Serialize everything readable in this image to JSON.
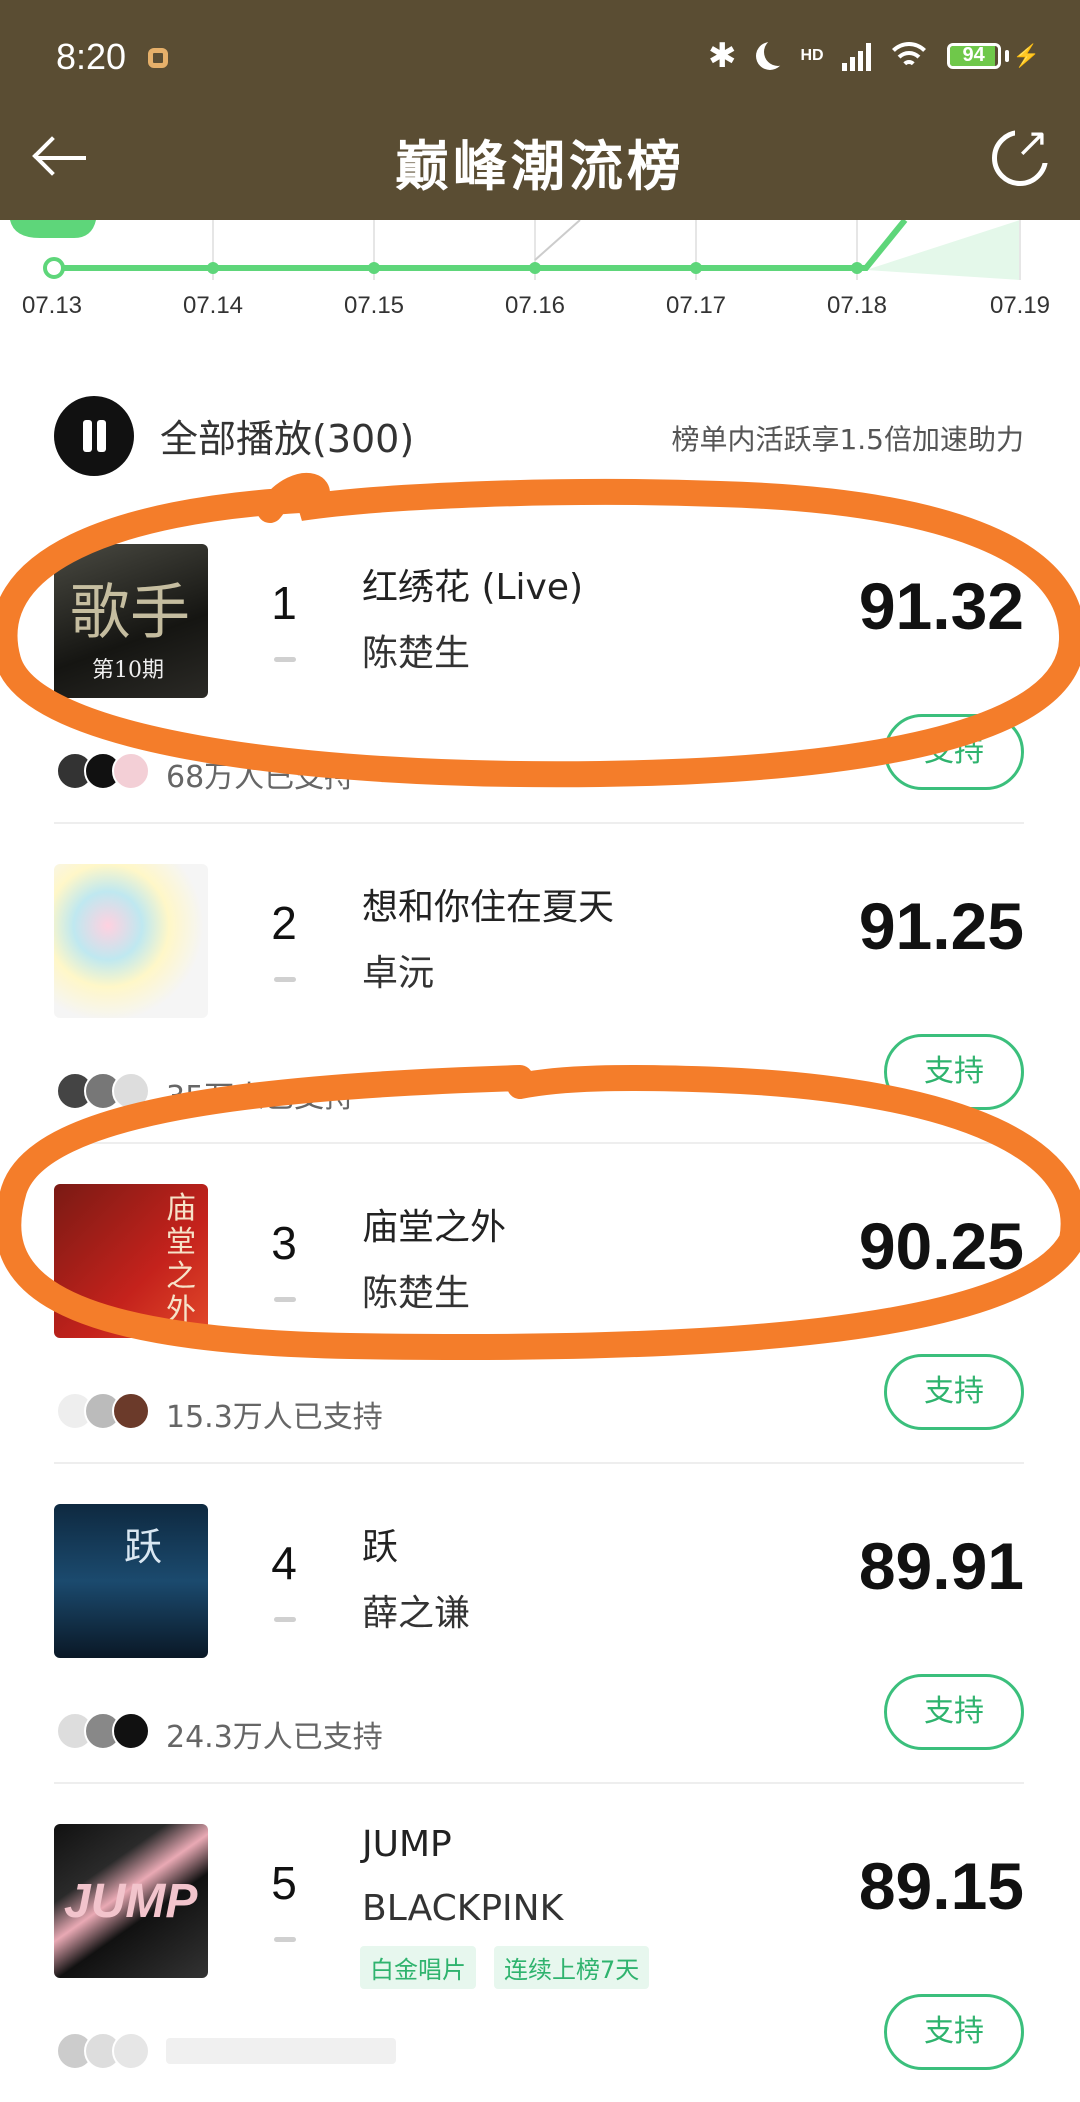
{
  "status": {
    "time": "8:20",
    "network_badge": "HD",
    "battery": "94",
    "battery_level": 0.94
  },
  "header": {
    "title": "巅峰潮流榜",
    "back_icon": "arrow-left-icon",
    "share_icon": "share-icon"
  },
  "trend": {
    "dates": [
      "07.13",
      "07.14",
      "07.15",
      "07.16",
      "07.17",
      "07.18",
      "07.19"
    ],
    "line_color": "#5ed67a"
  },
  "playbar": {
    "play_all": "全部播放(300)",
    "boost_text": "榜单内活跃享1.5倍加速助力"
  },
  "colors": {
    "accent": "#2fb36e",
    "header_bg": "#5a4d33",
    "annotation": "#f47d2a"
  },
  "songs": [
    {
      "rank": "1",
      "title": "红绣花 (Live)",
      "artist": "陈楚生",
      "score": "91.32",
      "supporters": "68万人已支持",
      "support_label": "支持"
    },
    {
      "rank": "2",
      "title": "想和你住在夏天",
      "artist": "卓沅",
      "score": "91.25",
      "supporters": "35万人已支持",
      "support_label": "支持"
    },
    {
      "rank": "3",
      "title": "庙堂之外",
      "artist": "陈楚生",
      "score": "90.25",
      "supporters": "15.3万人已支持",
      "support_label": "支持"
    },
    {
      "rank": "4",
      "title": "跃",
      "artist": "薛之谦",
      "score": "89.91",
      "supporters": "24.3万人已支持",
      "support_label": "支持"
    },
    {
      "rank": "5",
      "title": "JUMP",
      "artist": "BLACKPINK",
      "score": "89.15",
      "supporters": "",
      "support_label": "支持",
      "tags": [
        "白金唱片",
        "连续上榜7天"
      ]
    }
  ]
}
